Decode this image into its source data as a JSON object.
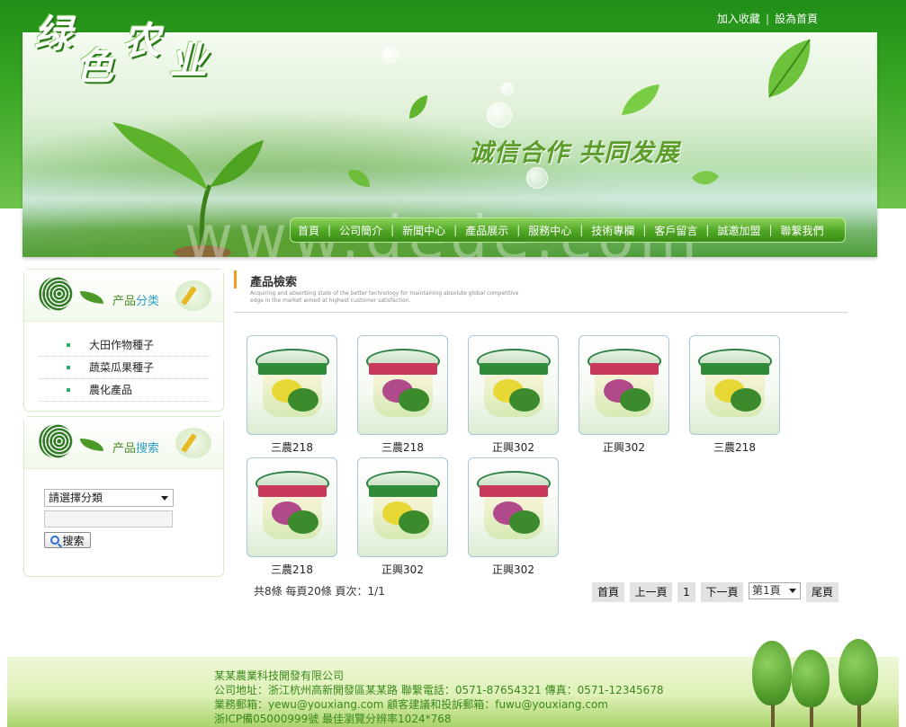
{
  "header": {
    "logo_text": "绿色农业",
    "logo_chars": [
      "绿",
      "色",
      "农",
      "业"
    ],
    "links": [
      "加入收藏",
      "設為首頁"
    ],
    "slogan": "诚信合作  共同发展",
    "watermark": "www.dede.com"
  },
  "nav": {
    "items": [
      "首頁",
      "公司簡介",
      "新聞中心",
      "產品展示",
      "服務中心",
      "技術專欄",
      "客戶留言",
      "誠邀加盟",
      "聯繫我們"
    ]
  },
  "sidebar": {
    "category_box": {
      "title_prefix": "产品",
      "title_suffix": "分类",
      "items": [
        "大田作物種子",
        "蔬菜瓜果種子",
        "農化產品"
      ]
    },
    "search_box": {
      "title_prefix": "产品",
      "title_suffix": "搜索",
      "select_value": "請選擇分類",
      "keyword_value": "",
      "button_label": "搜索"
    }
  },
  "main": {
    "title": "產品檢索",
    "subtitle": "Acquiring and absorbing state of the better technology for maintaining absolute global competitive edge in the market aimed at highest customer satisfaction.",
    "products": [
      {
        "name": "三農218",
        "band_color": "#2f8a3a",
        "flower_color": "#e8d836"
      },
      {
        "name": "三農218",
        "band_color": "#c8385a",
        "flower_color": "#b04a8a"
      },
      {
        "name": "正興302",
        "band_color": "#2f8a3a",
        "flower_color": "#e8d836"
      },
      {
        "name": "正興302",
        "band_color": "#c8385a",
        "flower_color": "#b04a8a"
      },
      {
        "name": "三農218",
        "band_color": "#2f8a3a",
        "flower_color": "#e8d836"
      },
      {
        "name": "三農218",
        "band_color": "#c8385a",
        "flower_color": "#b04a8a"
      },
      {
        "name": "正興302",
        "band_color": "#2f8a3a",
        "flower_color": "#e8d836"
      },
      {
        "name": "正興302",
        "band_color": "#c8385a",
        "flower_color": "#b04a8a"
      }
    ],
    "stats": "共8條 每頁20條 頁次：1/1",
    "pager": {
      "first": "首頁",
      "prev": "上一頁",
      "current": "1",
      "next": "下一頁",
      "page_select": "第1頁",
      "last": "尾頁"
    }
  },
  "footer": {
    "company": "某某農業科技開發有限公司",
    "address": "公司地址：浙江杭州高新開發區某某路 聯繫電話：0571-87654321   傳真：0571-12345678",
    "email": "業務郵箱：yewu@youxiang.com    顧客建議和投訴郵箱：fuwu@youxiang.com",
    "icp": "浙ICP備05000999號 最佳瀏覽分辨率1024*768"
  },
  "colors": {
    "brand_green": "#38a523",
    "nav_green": "#4fa624",
    "accent_orange": "#f39a1a",
    "footer_text": "#3a8a1a"
  }
}
